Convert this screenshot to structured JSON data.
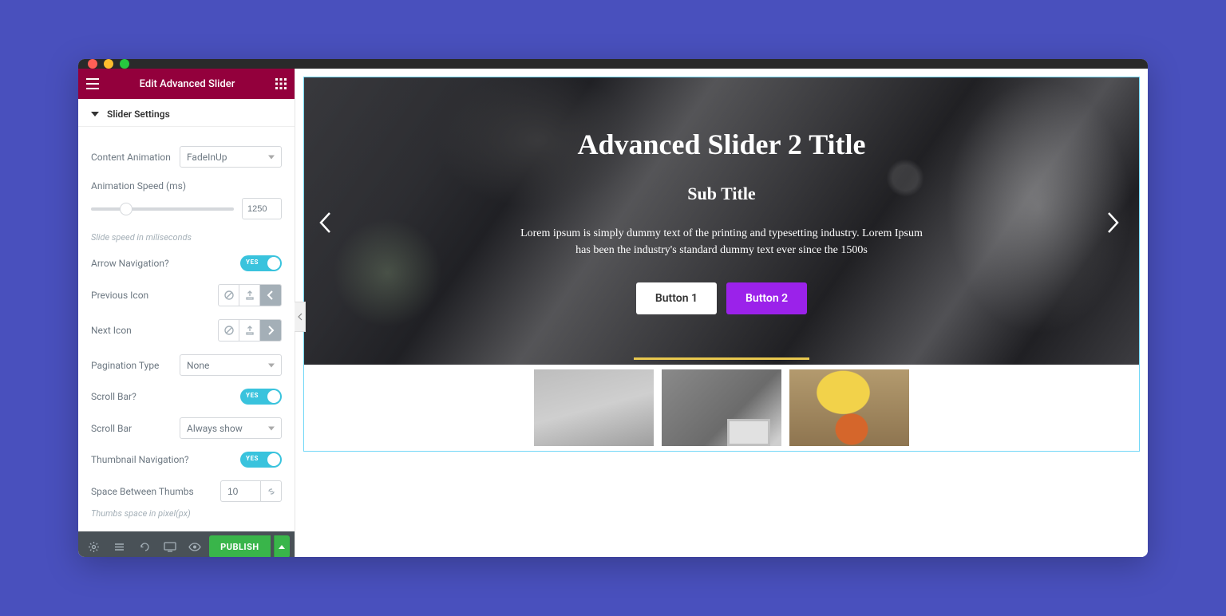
{
  "header": {
    "title": "Edit Advanced Slider"
  },
  "section": {
    "title": "Slider Settings"
  },
  "labels": {
    "content_animation": "Content Animation",
    "animation_speed": "Animation Speed (ms)",
    "speed_hint": "Slide speed in miliseconds",
    "arrow_nav": "Arrow Navigation?",
    "prev_icon": "Previous Icon",
    "next_icon": "Next Icon",
    "pagination_type": "Pagination Type",
    "scroll_bar_q": "Scroll Bar?",
    "scroll_bar": "Scroll Bar",
    "thumb_nav": "Thumbnail Navigation?",
    "space_thumbs": "Space Between Thumbs",
    "thumbs_hint": "Thumbs space in pixel(px)"
  },
  "values": {
    "content_animation": "FadeInUp",
    "animation_speed": "1250",
    "pagination_type": "None",
    "scroll_bar": "Always show",
    "space_thumbs": "10",
    "toggle_yes": "YES"
  },
  "bottom": {
    "publish": "PUBLISH"
  },
  "slide": {
    "title": "Advanced Slider 2 Title",
    "subtitle": "Sub Title",
    "desc": "Lorem ipsum is simply dummy text of the printing and typesetting industry. Lorem Ipsum has been the industry's standard dummy text ever since the 1500s",
    "btn1": "Button 1",
    "btn2": "Button 2"
  }
}
